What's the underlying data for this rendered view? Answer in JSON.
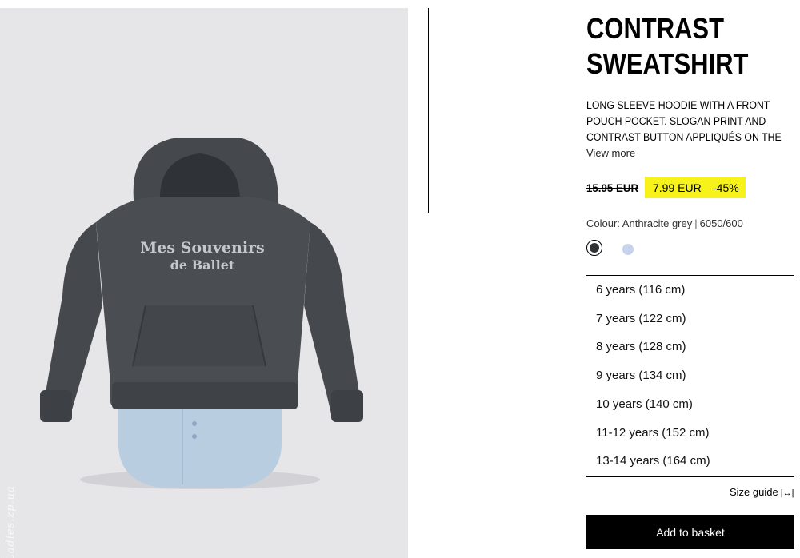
{
  "product": {
    "title": "CONTRAST SWEATSHIRT",
    "description": "LONG SLEEVE HOODIE WITH A FRONT POUCH POCKET. SLOGAN PRINT AND CONTRAST BUTTON APPLIQUÉS ON THE",
    "view_more": "View more",
    "old_price": "15.95 EUR",
    "new_price": "7.99 EUR",
    "discount": "-45%",
    "colour_label": "Colour: Anthracite grey",
    "reference": "6050/600",
    "image": {
      "print_line1": "Mes Souvenirs",
      "print_line2": "de Ballet",
      "watermark": "Ladies.zp.ua"
    }
  },
  "colors": {
    "highlight": "#f6f21a",
    "swatch_selected": "#2f3133",
    "swatch_other": "#c6d3ec",
    "button_bg": "#000000"
  },
  "sizes": [
    "6 years (116 cm)",
    "7 years (122 cm)",
    "8 years (128 cm)",
    "9 years (134 cm)",
    "10 years (140 cm)",
    "11-12 years (152 cm)",
    "13-14 years (164 cm)"
  ],
  "actions": {
    "size_guide": "Size guide",
    "size_guide_icon": "ruler-icon",
    "add_to_basket": "Add to basket"
  }
}
